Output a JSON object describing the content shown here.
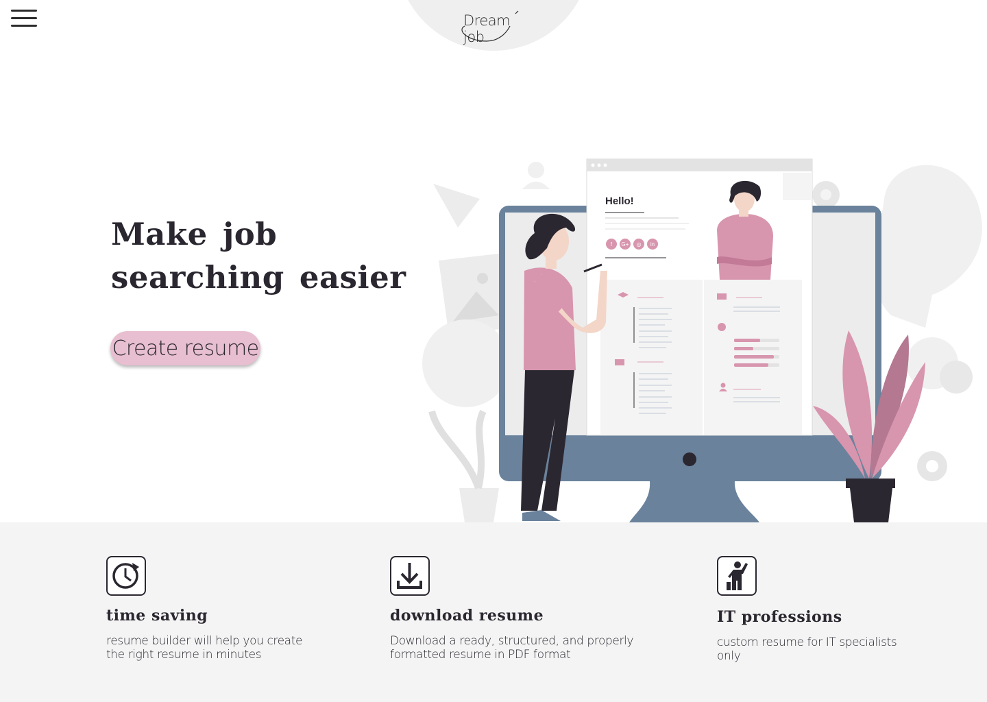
{
  "header": {
    "menu_icon": "hamburger-menu-icon",
    "logo_text": "Dream job"
  },
  "hero": {
    "title": "Make job searching easier",
    "cta_label": "Create resume"
  },
  "illustration": {
    "greeting": "Hello!",
    "social_icons": [
      "f",
      "G+",
      "◎",
      "in"
    ],
    "accent_color": "#d895ae",
    "monitor_color": "#6a829b",
    "dark_color": "#2b2730"
  },
  "features": [
    {
      "icon": "clock-refresh-icon",
      "title": "time saving",
      "desc_line1": "resume builder will help you create",
      "desc_line2": "the right resume in minutes"
    },
    {
      "icon": "download-icon",
      "title": "download resume",
      "desc_line1": "Download a ready, structured, and properly",
      "desc_line2": "formatted resume in PDF format"
    },
    {
      "icon": "it-professional-icon",
      "title": "IT professions",
      "desc_line1": "custom resume for IT specialists",
      "desc_line2": "only"
    }
  ]
}
